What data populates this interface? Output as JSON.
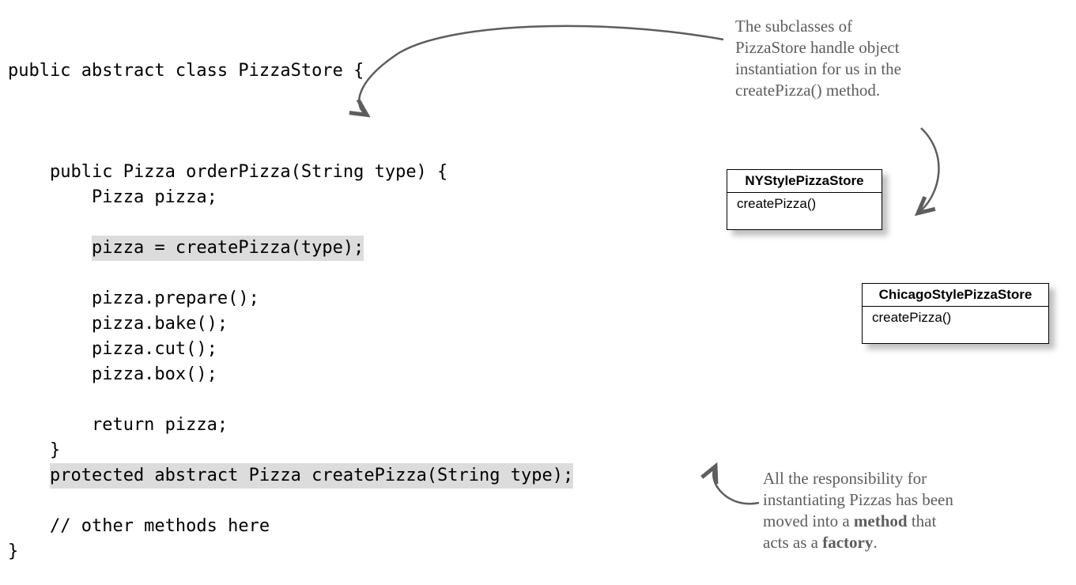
{
  "code": {
    "l1": "public abstract class PizzaStore {",
    "l2": "",
    "l3": "",
    "l4": "",
    "l5": "    public Pizza orderPizza(String type) {",
    "l6": "        Pizza pizza;",
    "l7": "",
    "l8_pad": "        ",
    "l8_hl": "pizza = createPizza(type);",
    "l9": "",
    "l10": "        pizza.prepare();",
    "l11": "        pizza.bake();",
    "l12": "        pizza.cut();",
    "l13": "        pizza.box();",
    "l14": "",
    "l15": "        return pizza;",
    "l16": "    }",
    "l17_pad": "    ",
    "l17_hl": "protected abstract Pizza createPizza(String type);",
    "l18": "",
    "l19": "    // other methods here",
    "l20": "}"
  },
  "uml": {
    "ny": {
      "title": "NYStylePizzaStore",
      "method": "createPizza()"
    },
    "chicago": {
      "title": "ChicagoStylePizzaStore",
      "method": "createPizza()"
    }
  },
  "annotations": {
    "top": "The subclasses of\nPizzaStore handle object\ninstantiation for us in the\ncreatePizza() method.",
    "bottom_pre": "All the responsibility for\ninstantiating Pizzas has been\nmoved into a ",
    "bottom_bold1": "method",
    "bottom_mid": " that\nacts as a ",
    "bottom_bold2": "factory",
    "bottom_post": "."
  }
}
